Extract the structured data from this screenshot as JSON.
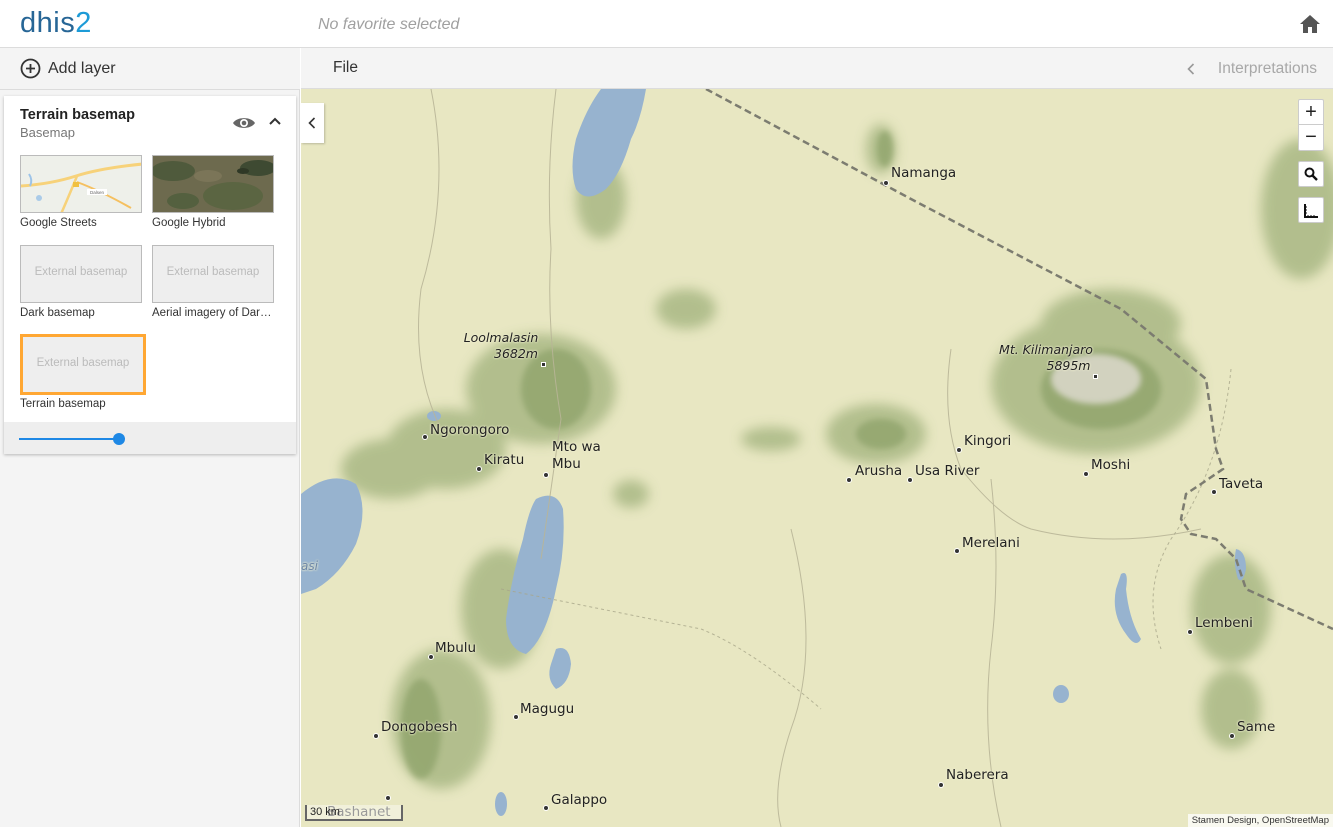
{
  "header": {
    "logo_part1": "dhis",
    "logo_part2": "2",
    "favorite_title": "No favorite selected",
    "home_icon": "home-icon"
  },
  "sidebar": {
    "add_layer_label": "Add layer",
    "layer_card": {
      "title": "Terrain basemap",
      "subtitle": "Basemap",
      "opacity": 0.8,
      "basemaps": [
        {
          "label": "Google Streets",
          "thumb": "streets"
        },
        {
          "label": "Google Hybrid",
          "thumb": "hybrid"
        },
        {
          "label": "Dark basemap",
          "thumb": "external",
          "thumb_text": "External basemap"
        },
        {
          "label": "Aerial imagery of Dar…",
          "thumb": "external",
          "thumb_text": "External basemap"
        },
        {
          "label": "Terrain basemap",
          "thumb": "external",
          "thumb_text": "External basemap",
          "selected": true
        }
      ]
    }
  },
  "toolbar": {
    "file_label": "File",
    "interpretations_label": "Interpretations"
  },
  "map": {
    "controls": {
      "zoom_in": "+",
      "zoom_out": "−"
    },
    "places": {
      "namanga": "Namanga",
      "loolmalasin_1": "Loolmalasin",
      "loolmalasin_2": "3682m",
      "kilimanjaro_1": "Mt. Kilimanjaro",
      "kilimanjaro_2": "5895m",
      "ngorongoro": "Ngorongoro",
      "kiratu": "Kiratu",
      "mto_wa_mbu_1": "Mto wa",
      "mto_wa_mbu_2": "Mbu",
      "kingori": "Kingori",
      "arusha": "Arusha",
      "usa_river": "Usa River",
      "moshi": "Moshi",
      "taveta": "Taveta",
      "merelani": "Merelani",
      "lembeni": "Lembeni",
      "mbulu": "Mbulu",
      "magugu": "Magugu",
      "dongobesh": "Dongobesh",
      "same": "Same",
      "naberera": "Naberera",
      "galappo": "Galappo",
      "bashanet": "Bashanet",
      "lake_fragment": "asi"
    },
    "scale_label": "30 km",
    "attribution": "Stamen Design, OpenStreetMap"
  }
}
